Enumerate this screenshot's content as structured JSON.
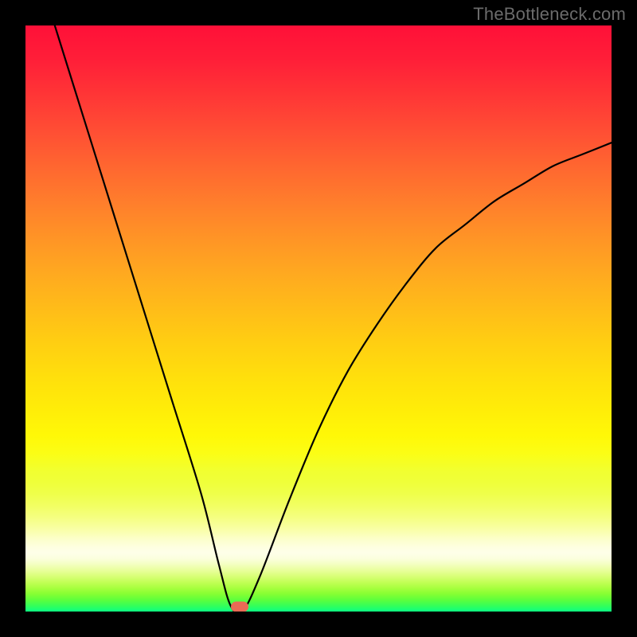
{
  "watermark": "TheBottleneck.com",
  "chart_data": {
    "type": "line",
    "title": "",
    "xlabel": "",
    "ylabel": "",
    "xlim": [
      0,
      100
    ],
    "ylim": [
      0,
      100
    ],
    "grid": false,
    "legend": false,
    "background": "rainbow-gradient",
    "series": [
      {
        "name": "bottleneck-curve",
        "x": [
          5,
          10,
          15,
          20,
          25,
          30,
          33,
          35,
          37,
          40,
          45,
          50,
          55,
          60,
          65,
          70,
          75,
          80,
          85,
          90,
          95,
          100
        ],
        "y": [
          100,
          84,
          68,
          52,
          36,
          20,
          8,
          1,
          0,
          6,
          19,
          31,
          41,
          49,
          56,
          62,
          66,
          70,
          73,
          76,
          78,
          80
        ]
      }
    ],
    "marker": {
      "x": 36.5,
      "y": 0.8,
      "color": "#e96a55"
    }
  },
  "colors": {
    "frame": "#000000",
    "curve": "#000000",
    "marker": "#e96a55",
    "watermark": "#6b6b6b"
  }
}
